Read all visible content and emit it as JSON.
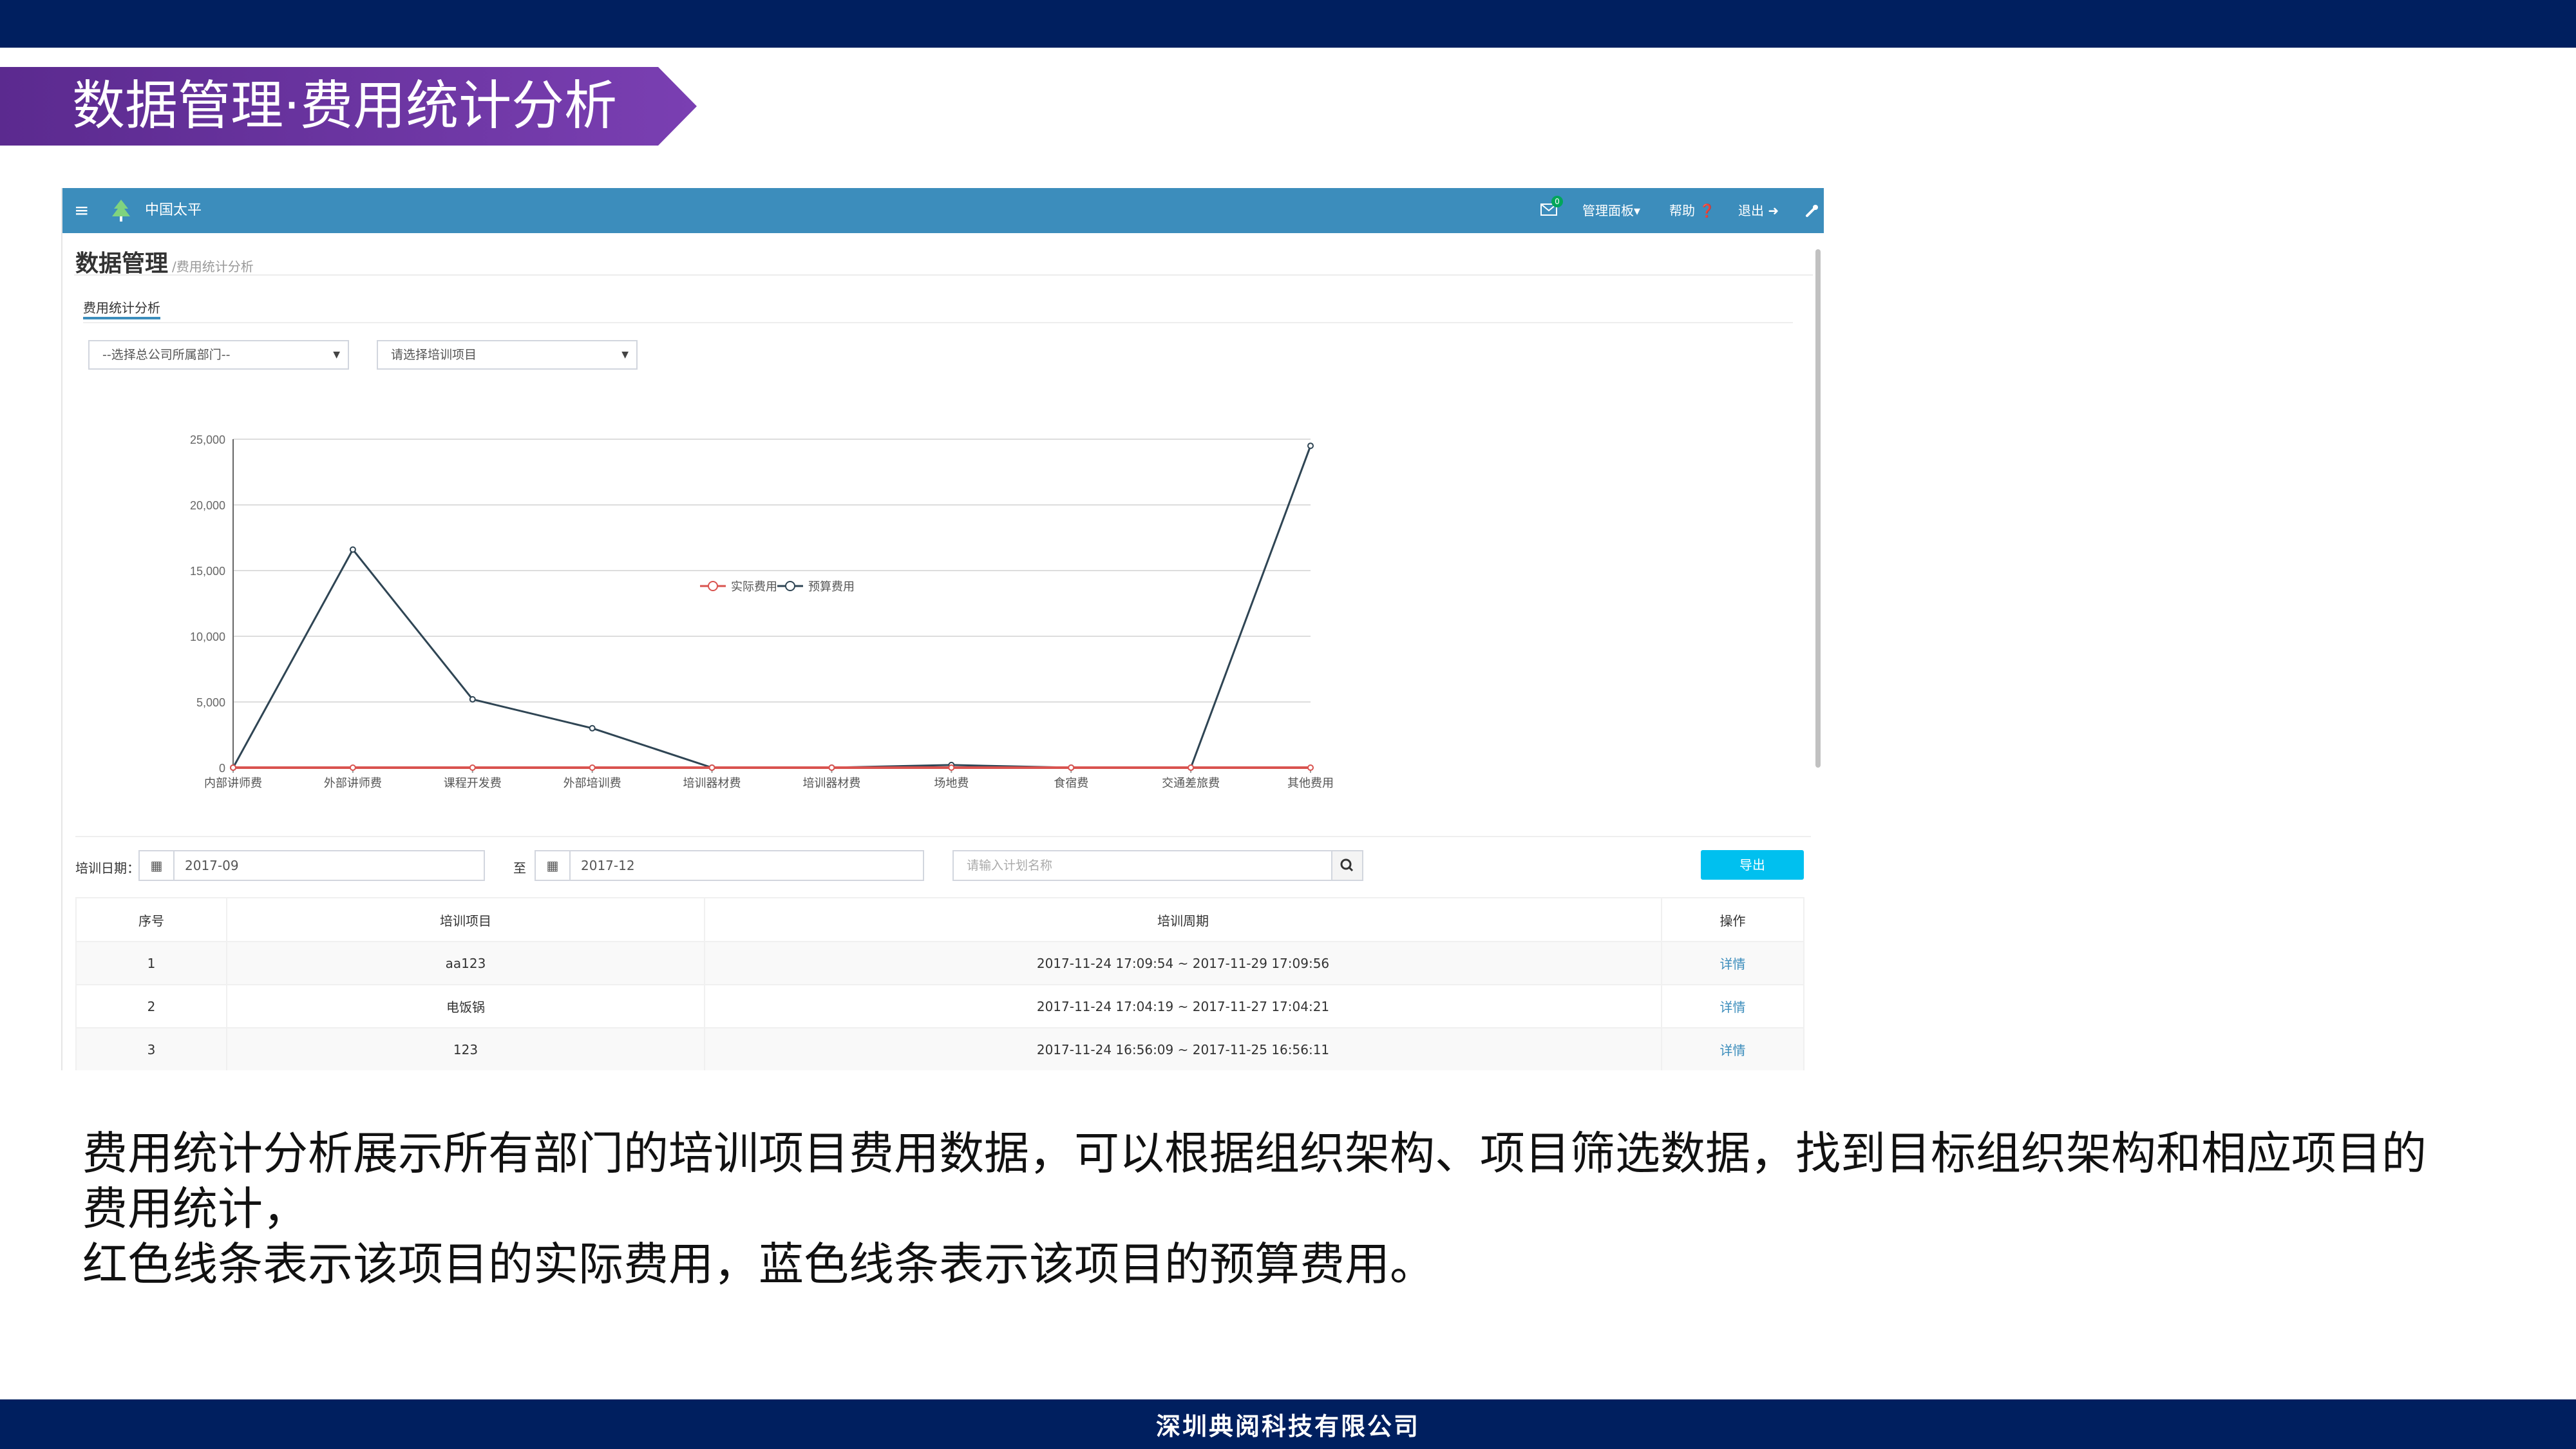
{
  "slide": {
    "title": "数据管理·费用统计分析",
    "description_lines": [
      "费用统计分析展示所有部门的培训项目费用数据，可以根据组织架构、项目筛选数据，找到目标组织架构和相应项目的费用统计，",
      "红色线条表示该项目的实际费用，蓝色线条表示该项目的预算费用。"
    ],
    "footer": "深圳典阅科技有限公司",
    "colors": {
      "band": "#001f5f",
      "banner_start": "#5b2a8f",
      "banner_end": "#7a3fb2"
    }
  },
  "app": {
    "brand": "中国太平",
    "nav": {
      "mail_badge": "0",
      "panel": "管理面板▾",
      "help": "帮助 ❓",
      "logout": "退出 ➜",
      "tools_icon": "wrench-icon"
    },
    "page_heading": "数据管理",
    "breadcrumb": "/费用统计分析",
    "tab": "费用统计分析",
    "select_department": "--选择总公司所属部门--",
    "select_project": "请选择培训项目",
    "filter": {
      "date_label": "培训日期：",
      "date_from": "2017-09",
      "to_label": "至",
      "date_to": "2017-12",
      "search_placeholder": "请输入计划名称",
      "export": "导出"
    },
    "table": {
      "headers": [
        "序号",
        "培训项目",
        "培训周期",
        "操作"
      ],
      "rows": [
        {
          "no": "1",
          "project": "aa123",
          "period": "2017-11-24 17:09:54 ~ 2017-11-29 17:09:56",
          "action": "详情"
        },
        {
          "no": "2",
          "project": "电饭锅",
          "period": "2017-11-24 17:04:19 ~ 2017-11-27 17:04:21",
          "action": "详情"
        },
        {
          "no": "3",
          "project": "123",
          "period": "2017-11-24 16:56:09 ~ 2017-11-25 16:56:11",
          "action": "详情"
        }
      ]
    },
    "colors": {
      "navbar": "#3c8dbc",
      "actual": "#d9534f",
      "budget": "#2f4554",
      "export": "#00c0ef"
    }
  },
  "chart_data": {
    "type": "line",
    "categories": [
      "内部讲师费",
      "外部讲师费",
      "课程开发费",
      "外部培训费",
      "培训器材费",
      "培训器材费",
      "场地费",
      "食宿费",
      "交通差旅费",
      "其他费用"
    ],
    "series": [
      {
        "name": "实际费用",
        "color": "#d9534f",
        "values": [
          0,
          0,
          0,
          0,
          0,
          0,
          0,
          0,
          0,
          0
        ]
      },
      {
        "name": "预算费用",
        "color": "#2f4554",
        "values": [
          0,
          16600,
          5200,
          3000,
          0,
          0,
          200,
          0,
          0,
          24500
        ]
      }
    ],
    "ylim": [
      0,
      25000
    ],
    "yticks": [
      "0",
      "5,000",
      "10,000",
      "15,000",
      "20,000",
      "25,000"
    ],
    "grid": true,
    "legend": "top-center"
  }
}
